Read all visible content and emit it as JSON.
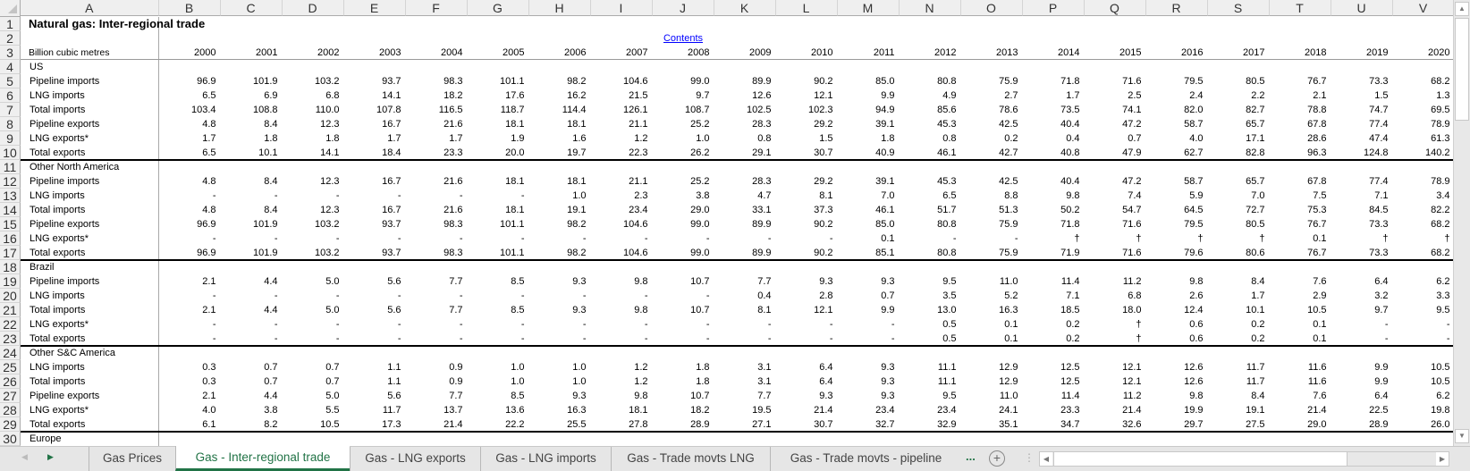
{
  "sheet": {
    "columns": [
      "A",
      "B",
      "C",
      "D",
      "E",
      "F",
      "G",
      "H",
      "I",
      "J",
      "K",
      "L",
      "M",
      "N",
      "O",
      "P",
      "Q",
      "R",
      "S",
      "T",
      "U",
      "V"
    ],
    "title": "Natural gas: Inter-regional trade",
    "contents_link": "Contents",
    "units_label": "Billion cubic metres",
    "years": [
      "2000",
      "2001",
      "2002",
      "2003",
      "2004",
      "2005",
      "2006",
      "2007",
      "2008",
      "2009",
      "2010",
      "2011",
      "2012",
      "2013",
      "2014",
      "2015",
      "2016",
      "2017",
      "2018",
      "2019",
      "2020"
    ],
    "rows": [
      {
        "label": "US",
        "values": []
      },
      {
        "label": "Pipeline imports",
        "values": [
          "96.9",
          "101.9",
          "103.2",
          "93.7",
          "98.3",
          "101.1",
          "98.2",
          "104.6",
          "99.0",
          "89.9",
          "90.2",
          "85.0",
          "80.8",
          "75.9",
          "71.8",
          "71.6",
          "79.5",
          "80.5",
          "76.7",
          "73.3",
          "68.2"
        ]
      },
      {
        "label": "LNG imports",
        "values": [
          "6.5",
          "6.9",
          "6.8",
          "14.1",
          "18.2",
          "17.6",
          "16.2",
          "21.5",
          "9.7",
          "12.6",
          "12.1",
          "9.9",
          "4.9",
          "2.7",
          "1.7",
          "2.5",
          "2.4",
          "2.2",
          "2.1",
          "1.5",
          "1.3"
        ]
      },
      {
        "label": "Total imports",
        "values": [
          "103.4",
          "108.8",
          "110.0",
          "107.8",
          "116.5",
          "118.7",
          "114.4",
          "126.1",
          "108.7",
          "102.5",
          "102.3",
          "94.9",
          "85.6",
          "78.6",
          "73.5",
          "74.1",
          "82.0",
          "82.7",
          "78.8",
          "74.7",
          "69.5"
        ]
      },
      {
        "label": "Pipeline exports",
        "values": [
          "4.8",
          "8.4",
          "12.3",
          "16.7",
          "21.6",
          "18.1",
          "18.1",
          "21.1",
          "25.2",
          "28.3",
          "29.2",
          "39.1",
          "45.3",
          "42.5",
          "40.4",
          "47.2",
          "58.7",
          "65.7",
          "67.8",
          "77.4",
          "78.9"
        ]
      },
      {
        "label": "LNG exports*",
        "values": [
          "1.7",
          "1.8",
          "1.8",
          "1.7",
          "1.7",
          "1.9",
          "1.6",
          "1.2",
          "1.0",
          "0.8",
          "1.5",
          "1.8",
          "0.8",
          "0.2",
          "0.4",
          "0.7",
          "4.0",
          "17.1",
          "28.6",
          "47.4",
          "61.3"
        ]
      },
      {
        "label": "Total exports",
        "border": "black",
        "values": [
          "6.5",
          "10.1",
          "14.1",
          "18.4",
          "23.3",
          "20.0",
          "19.7",
          "22.3",
          "26.2",
          "29.1",
          "30.7",
          "40.9",
          "46.1",
          "42.7",
          "40.8",
          "47.9",
          "62.7",
          "82.8",
          "96.3",
          "124.8",
          "140.2"
        ]
      },
      {
        "label": "Other North America",
        "values": []
      },
      {
        "label": "Pipeline imports",
        "values": [
          "4.8",
          "8.4",
          "12.3",
          "16.7",
          "21.6",
          "18.1",
          "18.1",
          "21.1",
          "25.2",
          "28.3",
          "29.2",
          "39.1",
          "45.3",
          "42.5",
          "40.4",
          "47.2",
          "58.7",
          "65.7",
          "67.8",
          "77.4",
          "78.9"
        ]
      },
      {
        "label": "LNG imports",
        "values": [
          "-",
          "-",
          "-",
          "-",
          "-",
          "-",
          "1.0",
          "2.3",
          "3.8",
          "4.7",
          "8.1",
          "7.0",
          "6.5",
          "8.8",
          "9.8",
          "7.4",
          "5.9",
          "7.0",
          "7.5",
          "7.1",
          "3.4"
        ]
      },
      {
        "label": "Total imports",
        "values": [
          "4.8",
          "8.4",
          "12.3",
          "16.7",
          "21.6",
          "18.1",
          "19.1",
          "23.4",
          "29.0",
          "33.1",
          "37.3",
          "46.1",
          "51.7",
          "51.3",
          "50.2",
          "54.7",
          "64.5",
          "72.7",
          "75.3",
          "84.5",
          "82.2"
        ]
      },
      {
        "label": "Pipeline exports",
        "values": [
          "96.9",
          "101.9",
          "103.2",
          "93.7",
          "98.3",
          "101.1",
          "98.2",
          "104.6",
          "99.0",
          "89.9",
          "90.2",
          "85.0",
          "80.8",
          "75.9",
          "71.8",
          "71.6",
          "79.5",
          "80.5",
          "76.7",
          "73.3",
          "68.2"
        ]
      },
      {
        "label": "LNG exports*",
        "values": [
          "-",
          "-",
          "-",
          "-",
          "-",
          "-",
          "-",
          "-",
          "-",
          "-",
          "-",
          "0.1",
          "-",
          "-",
          "†",
          "†",
          "†",
          "†",
          "0.1",
          "†",
          "†"
        ]
      },
      {
        "label": "Total exports",
        "border": "black",
        "values": [
          "96.9",
          "101.9",
          "103.2",
          "93.7",
          "98.3",
          "101.1",
          "98.2",
          "104.6",
          "99.0",
          "89.9",
          "90.2",
          "85.1",
          "80.8",
          "75.9",
          "71.9",
          "71.6",
          "79.6",
          "80.6",
          "76.7",
          "73.3",
          "68.2"
        ]
      },
      {
        "label": "Brazil",
        "values": []
      },
      {
        "label": "Pipeline imports",
        "values": [
          "2.1",
          "4.4",
          "5.0",
          "5.6",
          "7.7",
          "8.5",
          "9.3",
          "9.8",
          "10.7",
          "7.7",
          "9.3",
          "9.3",
          "9.5",
          "11.0",
          "11.4",
          "11.2",
          "9.8",
          "8.4",
          "7.6",
          "6.4",
          "6.2"
        ]
      },
      {
        "label": "LNG imports",
        "values": [
          "-",
          "-",
          "-",
          "-",
          "-",
          "-",
          "-",
          "-",
          "-",
          "0.4",
          "2.8",
          "0.7",
          "3.5",
          "5.2",
          "7.1",
          "6.8",
          "2.6",
          "1.7",
          "2.9",
          "3.2",
          "3.3"
        ]
      },
      {
        "label": "Total imports",
        "values": [
          "2.1",
          "4.4",
          "5.0",
          "5.6",
          "7.7",
          "8.5",
          "9.3",
          "9.8",
          "10.7",
          "8.1",
          "12.1",
          "9.9",
          "13.0",
          "16.3",
          "18.5",
          "18.0",
          "12.4",
          "10.1",
          "10.5",
          "9.7",
          "9.5"
        ]
      },
      {
        "label": "LNG exports*",
        "values": [
          "-",
          "-",
          "-",
          "-",
          "-",
          "-",
          "-",
          "-",
          "-",
          "-",
          "-",
          "-",
          "0.5",
          "0.1",
          "0.2",
          "†",
          "0.6",
          "0.2",
          "0.1",
          "-",
          "-"
        ]
      },
      {
        "label": "Total exports",
        "border": "black",
        "values": [
          "-",
          "-",
          "-",
          "-",
          "-",
          "-",
          "-",
          "-",
          "-",
          "-",
          "-",
          "-",
          "0.5",
          "0.1",
          "0.2",
          "†",
          "0.6",
          "0.2",
          "0.1",
          "-",
          "-"
        ]
      },
      {
        "label": "Other S&C America",
        "values": []
      },
      {
        "label": "LNG imports",
        "values": [
          "0.3",
          "0.7",
          "0.7",
          "1.1",
          "0.9",
          "1.0",
          "1.0",
          "1.2",
          "1.8",
          "3.1",
          "6.4",
          "9.3",
          "11.1",
          "12.9",
          "12.5",
          "12.1",
          "12.6",
          "11.7",
          "11.6",
          "9.9",
          "10.5"
        ]
      },
      {
        "label": "Total imports",
        "values": [
          "0.3",
          "0.7",
          "0.7",
          "1.1",
          "0.9",
          "1.0",
          "1.0",
          "1.2",
          "1.8",
          "3.1",
          "6.4",
          "9.3",
          "11.1",
          "12.9",
          "12.5",
          "12.1",
          "12.6",
          "11.7",
          "11.6",
          "9.9",
          "10.5"
        ]
      },
      {
        "label": "Pipeline exports",
        "values": [
          "2.1",
          "4.4",
          "5.0",
          "5.6",
          "7.7",
          "8.5",
          "9.3",
          "9.8",
          "10.7",
          "7.7",
          "9.3",
          "9.3",
          "9.5",
          "11.0",
          "11.4",
          "11.2",
          "9.8",
          "8.4",
          "7.6",
          "6.4",
          "6.2"
        ]
      },
      {
        "label": "LNG exports*",
        "values": [
          "4.0",
          "3.8",
          "5.5",
          "11.7",
          "13.7",
          "13.6",
          "16.3",
          "18.1",
          "18.2",
          "19.5",
          "21.4",
          "23.4",
          "23.4",
          "24.1",
          "23.3",
          "21.4",
          "19.9",
          "19.1",
          "21.4",
          "22.5",
          "19.8"
        ]
      },
      {
        "label": "Total exports",
        "border": "black",
        "values": [
          "6.1",
          "8.2",
          "10.5",
          "17.3",
          "21.4",
          "22.2",
          "25.5",
          "27.8",
          "28.9",
          "27.1",
          "30.7",
          "32.7",
          "32.9",
          "35.1",
          "34.7",
          "32.6",
          "29.7",
          "27.5",
          "29.0",
          "28.9",
          "26.0"
        ]
      },
      {
        "label": "Europe",
        "values": []
      }
    ]
  },
  "tabs": [
    {
      "label": "Gas Prices",
      "active": false
    },
    {
      "label": "Gas - Inter-regional trade",
      "active": true
    },
    {
      "label": "Gas - LNG exports",
      "active": false
    },
    {
      "label": "Gas - LNG imports",
      "active": false
    },
    {
      "label": "Gas - Trade movts LNG",
      "active": false
    },
    {
      "label": "Gas - Trade movts - pipeline",
      "active": false
    }
  ],
  "tabbar": {
    "more_label": "...",
    "add_label": "+"
  },
  "colors": {
    "accent": "#217346",
    "link": "#0000ff",
    "header_bg": "#efefef"
  }
}
